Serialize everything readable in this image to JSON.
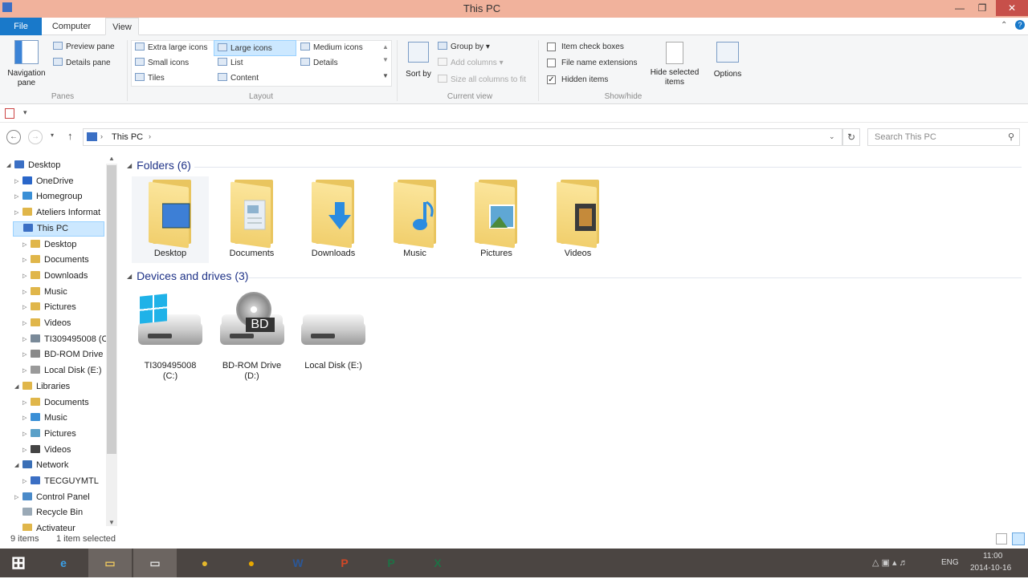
{
  "window": {
    "title": "This PC"
  },
  "tabs": {
    "file": "File",
    "computer": "Computer",
    "view": "View"
  },
  "ribbon": {
    "panes": {
      "navigation_pane": "Navigation pane",
      "preview_pane": "Preview pane",
      "details_pane": "Details pane",
      "group_label": "Panes"
    },
    "layout": {
      "options": [
        "Extra large icons",
        "Large icons",
        "Medium icons",
        "Small icons",
        "List",
        "Details",
        "Tiles",
        "Content"
      ],
      "selected": "Large icons",
      "group_label": "Layout"
    },
    "current_view": {
      "sort_by": "Sort by",
      "group_by": "Group by",
      "add_columns": "Add columns",
      "size_columns": "Size all columns to fit",
      "group_label": "Current view"
    },
    "show_hide": {
      "item_check_boxes": "Item check boxes",
      "item_check_boxes_checked": false,
      "file_name_extensions": "File name extensions",
      "file_name_extensions_checked": false,
      "hidden_items": "Hidden items",
      "hidden_items_checked": true,
      "hide_selected": "Hide selected items",
      "group_label": "Show/hide"
    },
    "options": "Options"
  },
  "address": {
    "path": "This PC",
    "search_placeholder": "Search This PC"
  },
  "nav": [
    {
      "label": "Desktop",
      "level": 0,
      "arrow": "open",
      "color": "#3b6fc4"
    },
    {
      "label": "OneDrive",
      "level": 1,
      "arrow": "closed",
      "color": "#2a66c9"
    },
    {
      "label": "Homegroup",
      "level": 1,
      "arrow": "closed",
      "color": "#3a8fd6"
    },
    {
      "label": "Ateliers Informat",
      "level": 1,
      "arrow": "closed",
      "color": "#e0b64a"
    },
    {
      "label": "This PC",
      "level": 1,
      "arrow": "open",
      "color": "#3b6fc4",
      "selected": true
    },
    {
      "label": "Desktop",
      "level": 2,
      "arrow": "closed",
      "color": "#e0b64a"
    },
    {
      "label": "Documents",
      "level": 2,
      "arrow": "closed",
      "color": "#e0b64a"
    },
    {
      "label": "Downloads",
      "level": 2,
      "arrow": "closed",
      "color": "#e0b64a"
    },
    {
      "label": "Music",
      "level": 2,
      "arrow": "closed",
      "color": "#e0b64a"
    },
    {
      "label": "Pictures",
      "level": 2,
      "arrow": "closed",
      "color": "#e0b64a"
    },
    {
      "label": "Videos",
      "level": 2,
      "arrow": "closed",
      "color": "#e0b64a"
    },
    {
      "label": "TI309495008 (C",
      "level": 2,
      "arrow": "closed",
      "color": "#7a8a99"
    },
    {
      "label": "BD-ROM Drive",
      "level": 2,
      "arrow": "closed",
      "color": "#8a8a8a"
    },
    {
      "label": "Local Disk (E:)",
      "level": 2,
      "arrow": "closed",
      "color": "#9a9a9a"
    },
    {
      "label": "Libraries",
      "level": 1,
      "arrow": "open",
      "color": "#e0b64a"
    },
    {
      "label": "Documents",
      "level": 2,
      "arrow": "closed",
      "color": "#e0b64a"
    },
    {
      "label": "Music",
      "level": 2,
      "arrow": "closed",
      "color": "#3a8fd6"
    },
    {
      "label": "Pictures",
      "level": 2,
      "arrow": "closed",
      "color": "#5aa0c8"
    },
    {
      "label": "Videos",
      "level": 2,
      "arrow": "closed",
      "color": "#444"
    },
    {
      "label": "Network",
      "level": 1,
      "arrow": "open",
      "color": "#3a6fb6"
    },
    {
      "label": "TECGUYMTL",
      "level": 2,
      "arrow": "closed",
      "color": "#3b6fc4"
    },
    {
      "label": "Control Panel",
      "level": 1,
      "arrow": "closed",
      "color": "#4a8ac9"
    },
    {
      "label": "Recycle Bin",
      "level": 1,
      "arrow": "none",
      "color": "#9aa9b6"
    },
    {
      "label": "Activateur",
      "level": 1,
      "arrow": "none",
      "color": "#e0b64a"
    }
  ],
  "folders": {
    "header": "Folders (6)",
    "items": [
      {
        "label": "Desktop",
        "badge": "desktop",
        "color": "#3d7fd6"
      },
      {
        "label": "Documents",
        "badge": "documents",
        "color": "#e7eef5"
      },
      {
        "label": "Downloads",
        "badge": "downloads",
        "color": "#2b8ce0"
      },
      {
        "label": "Music",
        "badge": "music",
        "color": "#2b8ce0"
      },
      {
        "label": "Pictures",
        "badge": "pictures",
        "color": "#5fa7d4"
      },
      {
        "label": "Videos",
        "badge": "videos",
        "color": "#3b3b3b"
      }
    ]
  },
  "drives": {
    "header": "Devices and drives (3)",
    "items": [
      {
        "label": "TI309495008 (C:)",
        "kind": "windows"
      },
      {
        "label": "BD-ROM Drive (D:)",
        "kind": "bd",
        "badge": "BD"
      },
      {
        "label": "Local Disk (E:)",
        "kind": "disk"
      }
    ]
  },
  "status": {
    "items": "9 items",
    "selected": "1 item selected"
  },
  "taskbar": {
    "apps": [
      {
        "name": "start",
        "glyph": "⊞"
      },
      {
        "name": "internet-explorer",
        "glyph": "e",
        "color": "#3aa0e8"
      },
      {
        "name": "file-explorer",
        "glyph": "▭",
        "color": "#e9c55f"
      },
      {
        "name": "explorer-window",
        "glyph": "▭",
        "color": "#ddd"
      },
      {
        "name": "chrome",
        "glyph": "●",
        "color": "#e5b82b"
      },
      {
        "name": "norton",
        "glyph": "●",
        "color": "#e8a800"
      },
      {
        "name": "word",
        "glyph": "W",
        "color": "#2b5797"
      },
      {
        "name": "powerpoint",
        "glyph": "P",
        "color": "#d24726"
      },
      {
        "name": "publisher",
        "glyph": "P",
        "color": "#1e7145"
      },
      {
        "name": "excel",
        "glyph": "X",
        "color": "#1e7145"
      }
    ],
    "lang": "ENG",
    "time": "11:00",
    "date": "2014-10-16"
  }
}
